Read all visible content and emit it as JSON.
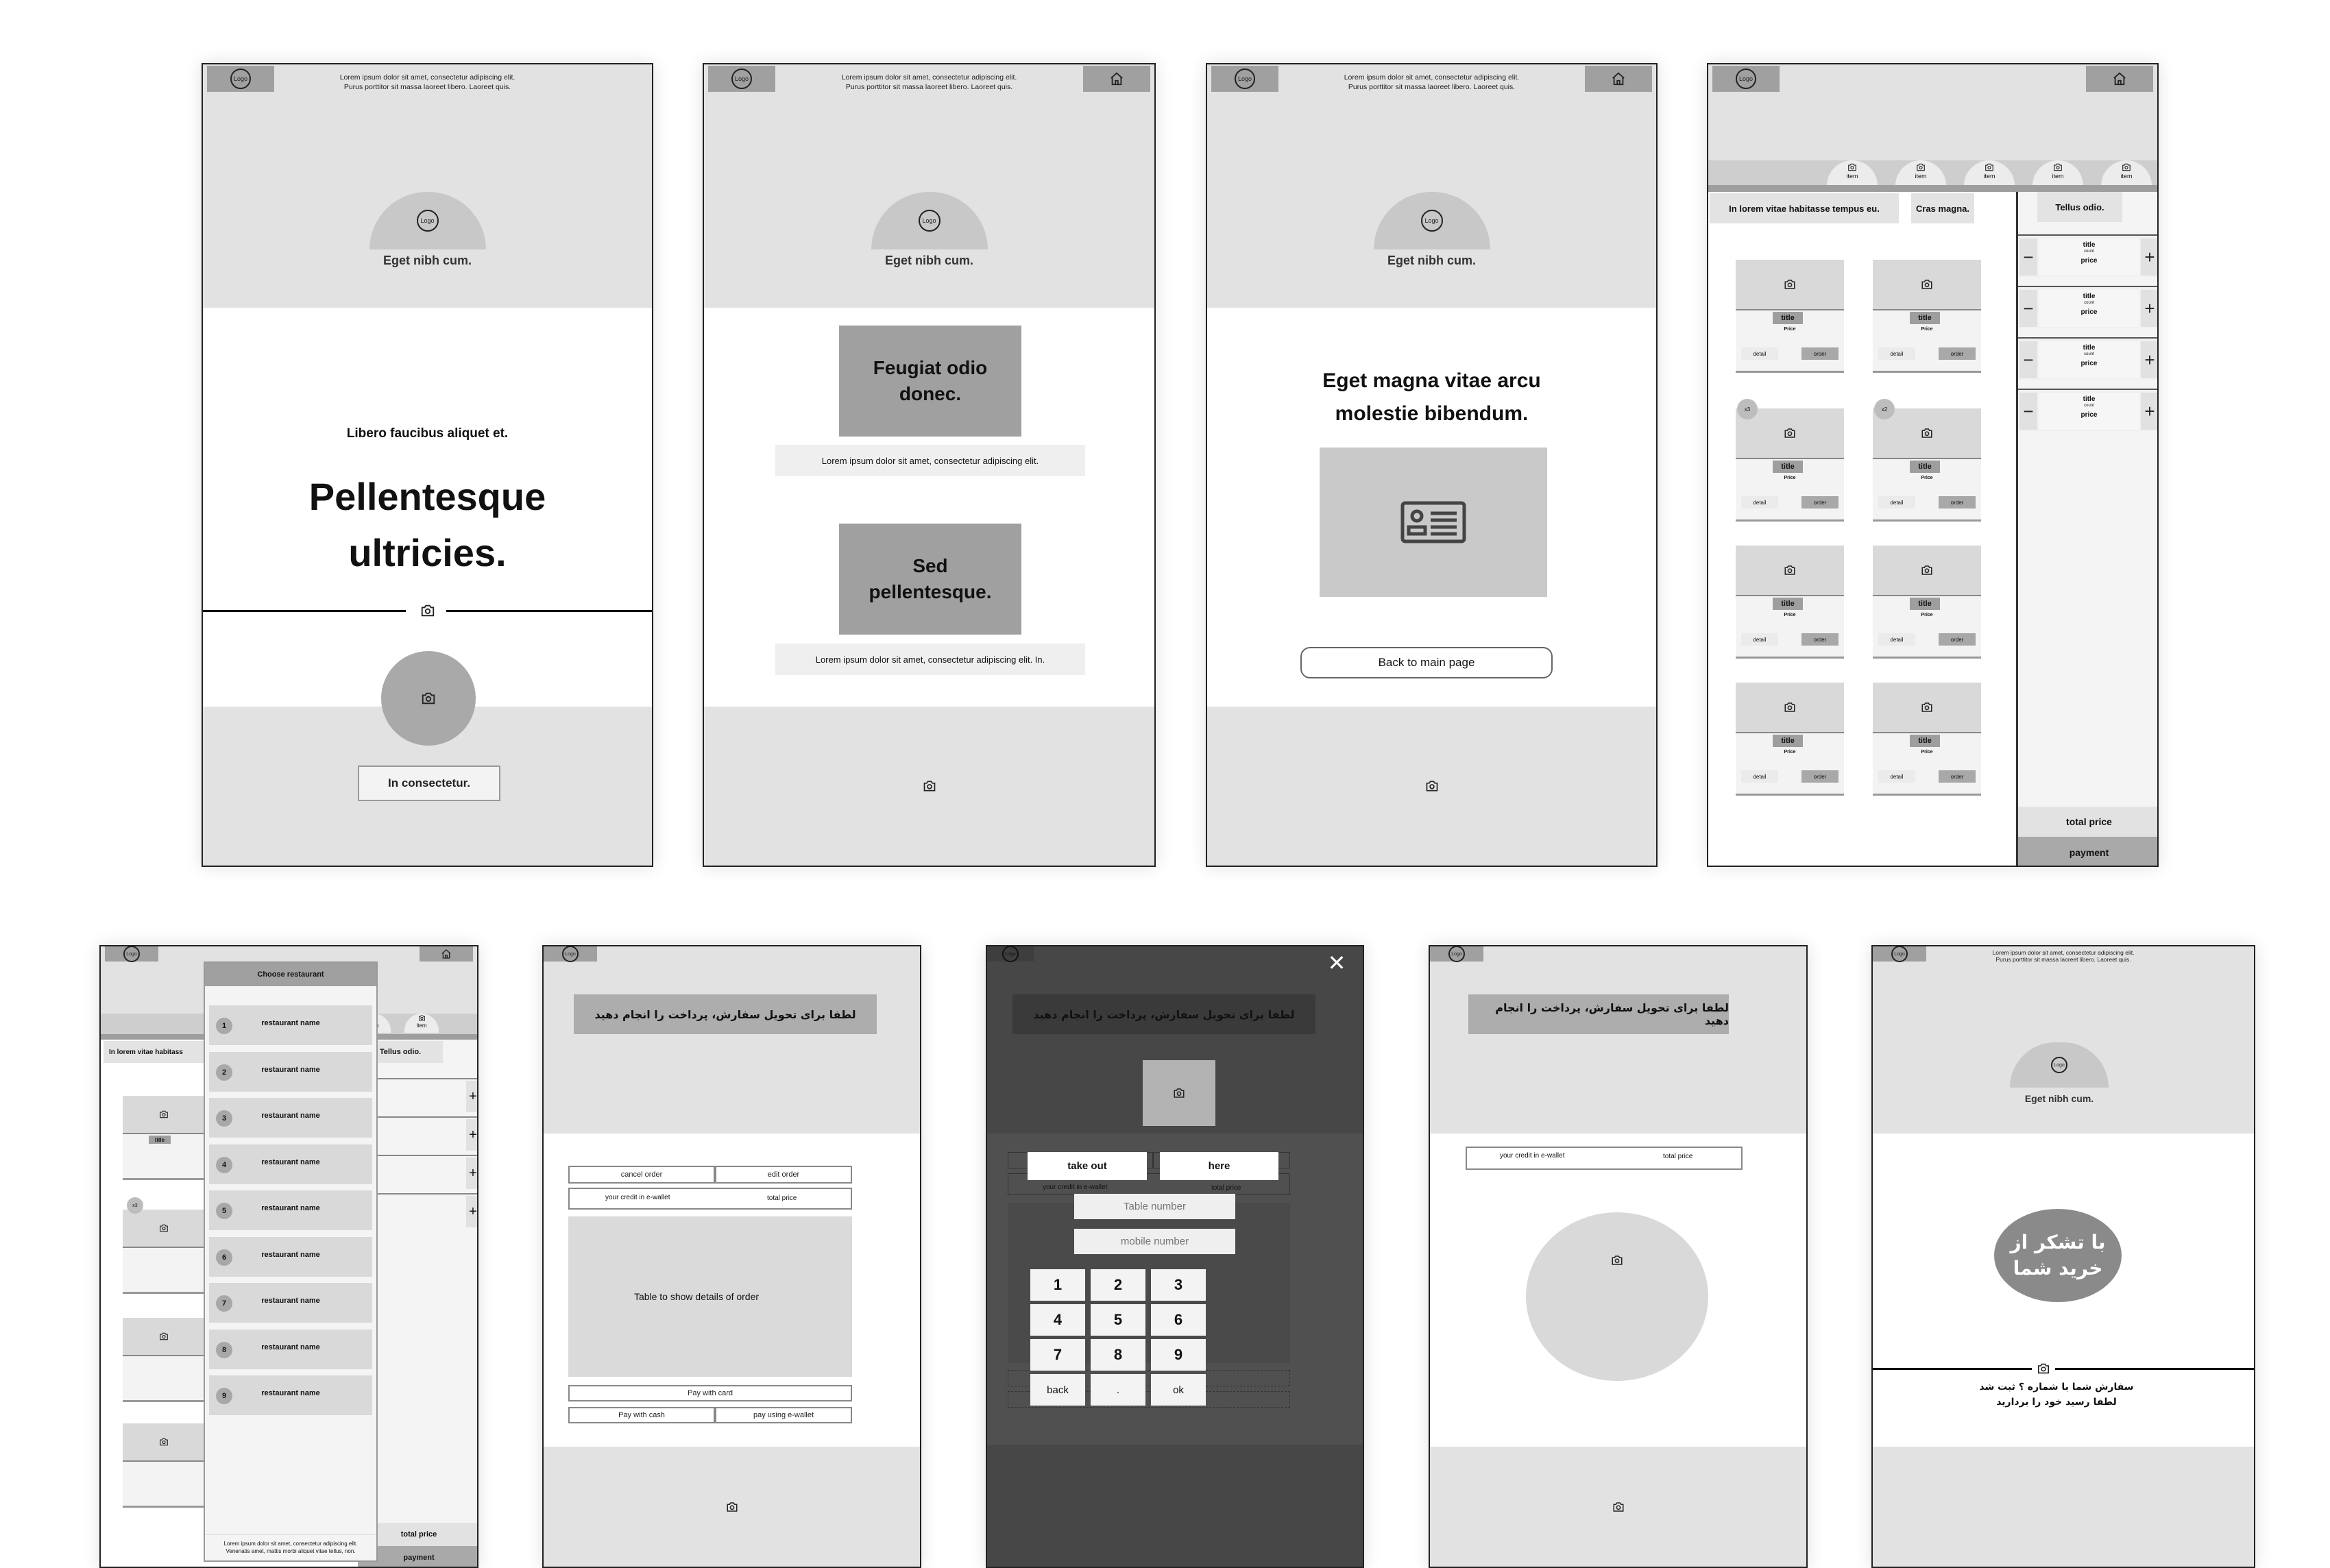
{
  "common": {
    "logo_label": "Logo",
    "header_lorem_line1": "Lorem ipsum dolor sit amet, consectetur adipiscing elit.",
    "header_lorem_line2": "Purus porttitor sit massa laoreet libero. Laoreet quis.",
    "dome_caption": "Eget nibh cum.",
    "icons": {
      "home": "home-icon",
      "camera": "camera-icon",
      "id_card": "id-card-icon",
      "close": "close-icon",
      "plus": "plus-icon",
      "minus": "minus-icon"
    }
  },
  "screen1": {
    "subtitle": "Libero faucibus aliquet et.",
    "title_line1": "Pellentesque",
    "title_line2": "ultricies.",
    "button_label": "In consectetur."
  },
  "screen2": {
    "cards": [
      {
        "title": "Feugiat odio donec.",
        "caption": "Lorem ipsum dolor sit amet, consectetur adipiscing elit."
      },
      {
        "title": "Sed pellentesque.",
        "caption": "Lorem ipsum dolor sit amet, consectetur adipiscing elit. In."
      }
    ]
  },
  "screen3": {
    "heading_line1": "Eget magna vitae arcu",
    "heading_line2": "molestie bibendum.",
    "back_button": "Back to main page"
  },
  "menu_screen": {
    "tabs": [
      "item",
      "item",
      "item",
      "item",
      "item"
    ],
    "category_heading": "In lorem vitae habitasse tempus eu.",
    "category_tag": "Cras magna.",
    "cart_title": "Tellus odio.",
    "cards": [
      {
        "title": "title",
        "price": "Price",
        "detail": "detail",
        "order": "order",
        "badge": ""
      },
      {
        "title": "title",
        "price": "Price",
        "detail": "detail",
        "order": "order",
        "badge": ""
      },
      {
        "title": "title",
        "price": "Price",
        "detail": "detail",
        "order": "order",
        "badge": "x3"
      },
      {
        "title": "title",
        "price": "Price",
        "detail": "detail",
        "order": "order",
        "badge": "x2"
      },
      {
        "title": "title",
        "price": "Price",
        "detail": "detail",
        "order": "order",
        "badge": ""
      },
      {
        "title": "title",
        "price": "Price",
        "detail": "detail",
        "order": "order",
        "badge": ""
      },
      {
        "title": "title",
        "price": "Price",
        "detail": "detail",
        "order": "order",
        "badge": ""
      },
      {
        "title": "title",
        "price": "Price",
        "detail": "detail",
        "order": "order",
        "badge": ""
      }
    ],
    "cart_items": [
      {
        "title": "title",
        "count": "count",
        "price": "price"
      },
      {
        "title": "title",
        "count": "count",
        "price": "price"
      },
      {
        "title": "title",
        "count": "count",
        "price": "price"
      },
      {
        "title": "title",
        "count": "count",
        "price": "price"
      }
    ],
    "total_price": "total price",
    "payment": "payment"
  },
  "restaurant_modal": {
    "title": "Choose restaurant",
    "items": [
      {
        "num": "1",
        "name": "restaurant name"
      },
      {
        "num": "2",
        "name": "restaurant name"
      },
      {
        "num": "3",
        "name": "restaurant name"
      },
      {
        "num": "4",
        "name": "restaurant name"
      },
      {
        "num": "5",
        "name": "restaurant name"
      },
      {
        "num": "6",
        "name": "restaurant name"
      },
      {
        "num": "7",
        "name": "restaurant name"
      },
      {
        "num": "8",
        "name": "restaurant name"
      },
      {
        "num": "9",
        "name": "restaurant name"
      }
    ],
    "footer_line1": "Lorem ipsum dolor sit amet, consectetur adipiscing elit.",
    "footer_line2": "Venenatis amet, mattis morbi aliquet vitae tellus, non.",
    "bg_heading": "In lorem vitae habitass",
    "bg_cart_title": "Tellus odio.",
    "bg_badge": "x3"
  },
  "order_screen": {
    "banner": "لطفا برای تحویل سفارش، پرداخت را انجام دهید",
    "cancel_order": "cancel order",
    "edit_order": "edit order",
    "credit_label": "your credit in e-wallet",
    "total_label": "total price",
    "table_placeholder": "Table to show details of order",
    "pay_card": "Pay with card",
    "pay_cash": "Pay with cash",
    "pay_wallet": "pay using e-wallet"
  },
  "keypad_modal": {
    "take_out": "take out",
    "here": "here",
    "table_number_placeholder": "Table number",
    "mobile_number_placeholder": "mobile number",
    "keys": [
      "1",
      "2",
      "3",
      "4",
      "5",
      "6",
      "7",
      "8",
      "9",
      "back",
      ".",
      "ok"
    ]
  },
  "wallet_screen": {
    "banner": "لطفا برای تحویل سفارش، پرداخت را انجام دهید",
    "credit_label": "your credit in e-wallet",
    "total_label": "total price"
  },
  "thanks_screen": {
    "circle_line1": "با تشکر از",
    "circle_line2": "خرید شما",
    "message_line1": "سفارش شما با شماره ؟ ثبت شد",
    "message_line2": "لطفا رسید خود را بردارید"
  }
}
